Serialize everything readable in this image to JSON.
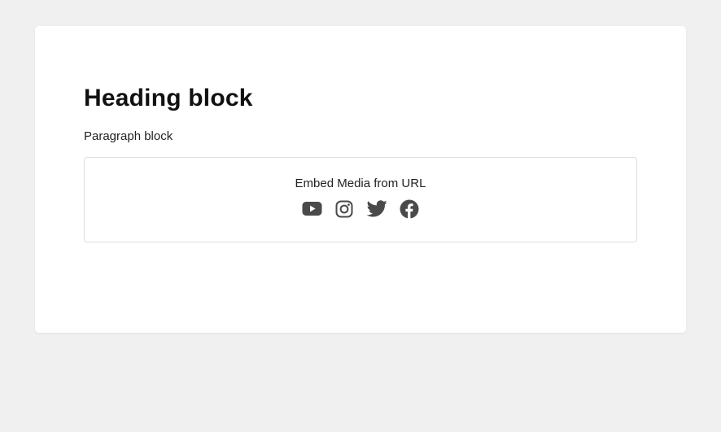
{
  "editor": {
    "heading": "Heading block",
    "paragraph": "Paragraph block",
    "embed": {
      "title": "Embed Media from URL",
      "providers": [
        {
          "name": "youtube-icon"
        },
        {
          "name": "instagram-icon"
        },
        {
          "name": "twitter-icon"
        },
        {
          "name": "facebook-icon"
        }
      ]
    }
  },
  "colors": {
    "page_background": "#f0f0f0",
    "card_background": "#ffffff",
    "icon_color": "#4a4a4a",
    "border": "#dedede"
  }
}
